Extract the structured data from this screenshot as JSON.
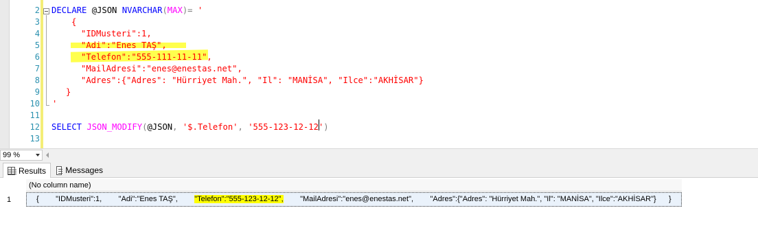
{
  "editor": {
    "line_numbers": [
      "2",
      "3",
      "4",
      "5",
      "6",
      "7",
      "8",
      "9",
      "10",
      "11",
      "12",
      "13"
    ],
    "lines": {
      "l2": {
        "kw": "DECLARE",
        "var": " @JSON ",
        "type": "NVARCHAR",
        "open": "(",
        "max": "MAX",
        "close": ")=",
        "str": " '"
      },
      "l4": "{",
      "l5": "\"IDMusteri\":1,",
      "l6": "\"Adi\":\"Enes TAŞ\",",
      "l7": "\"Telefon\":\"555-111-11-11\",",
      "l8": "\"MailAdresi\":\"enes@enestas.net\",",
      "l9": "\"Adres\":{\"Adres\": \"Hürriyet Mah.\", \"Il\": \"MANİSA\", \"Ilce\":\"AKHİSAR\"}",
      "l10": "}",
      "l11": "'",
      "l12": {
        "kw": "SELECT",
        "fn": "JSON_MODIFY",
        "open": "(",
        "var": "@JSON",
        "comma1": ", ",
        "path": "'$.Telefon'",
        "comma2": ", ",
        "value": "'555-123-12-12'",
        "close": ")"
      }
    }
  },
  "zoom": {
    "value": "99 %"
  },
  "results": {
    "tabs": {
      "results_label": "Results",
      "messages_label": "Messages",
      "active": "Results"
    },
    "column_header": "(No column name)",
    "row_number": "1",
    "cell_before": "{        \"IDMusteri\":1,        \"Adi\":\"Enes TAŞ\",        ",
    "cell_highlight": "\"Telefon\":\"555-123-12-12\",",
    "cell_after": "        \"MailAdresi\":\"enes@enestas.net\",        \"Adres\":{\"Adres\": \"Hürriyet Mah.\", \"Il\": \"MANİSA\", \"Ilce\":\"AKHİSAR\"}      }"
  },
  "colors": {
    "highlight": "#ffff4d",
    "keyword": "#0000ff",
    "string": "#ff0000",
    "function": "#ff00ff",
    "line_number": "#2b91af"
  }
}
